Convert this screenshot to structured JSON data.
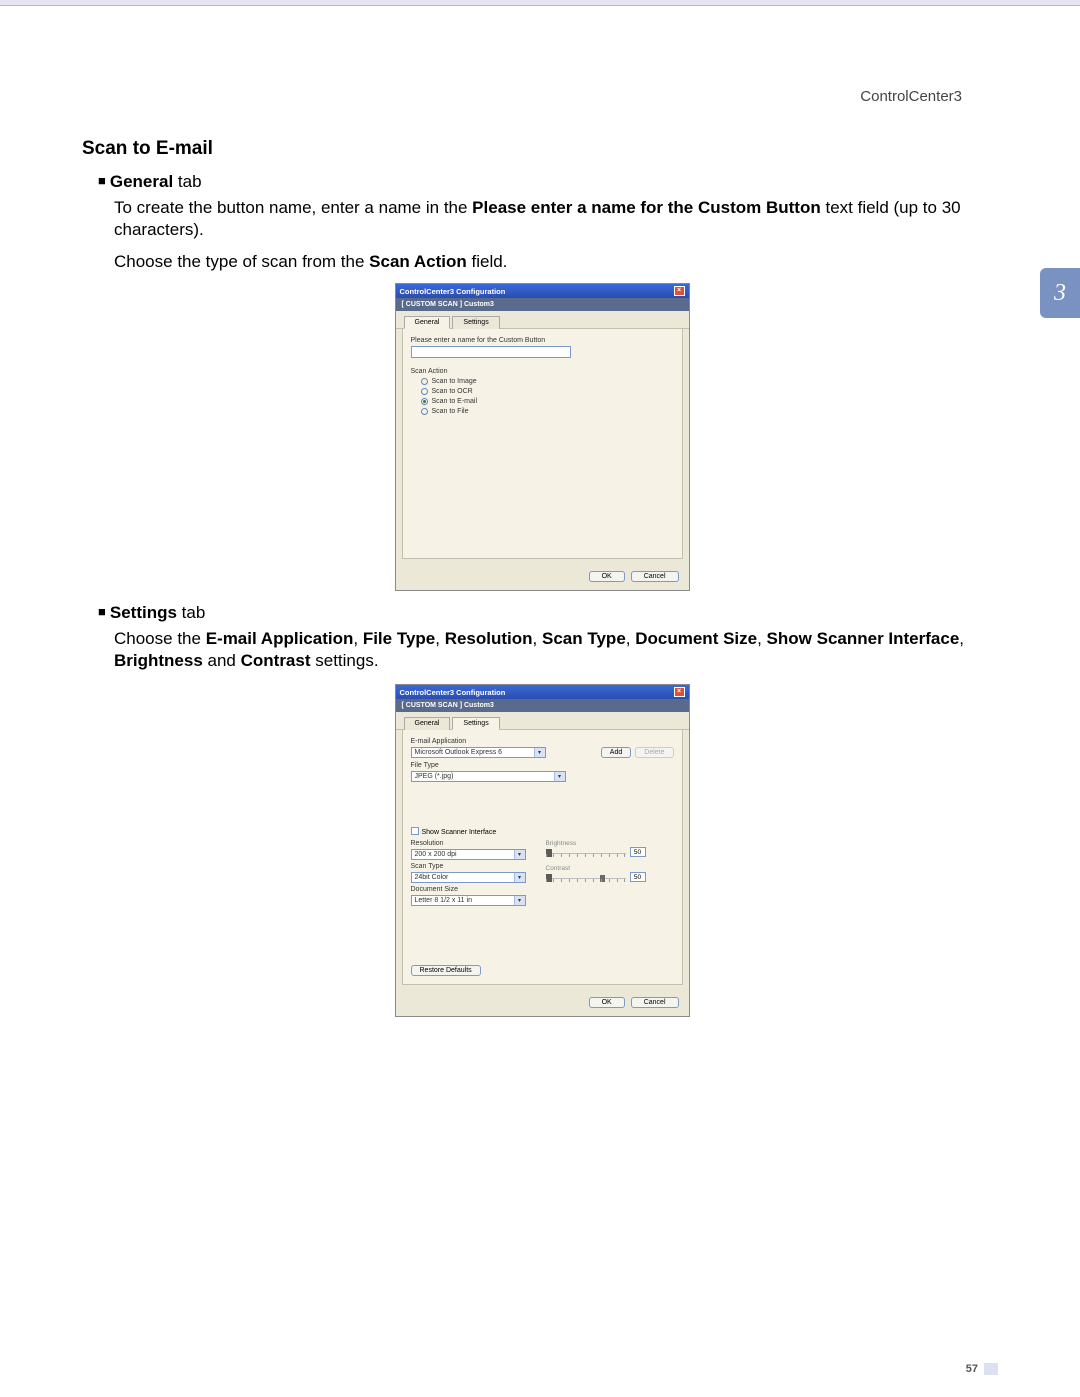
{
  "header": {
    "label": "ControlCenter3"
  },
  "section_title": "Scan to E-mail",
  "chapter_tab": "3",
  "page_number": "57",
  "general": {
    "heading_bold": "General",
    "heading_suffix": " tab",
    "para1_pre": "To create the button name, enter a name in the ",
    "para1_bold": "Please enter a name for the Custom Button",
    "para1_post": " text field (up to 30 characters).",
    "para2_pre": "Choose the type of scan from the ",
    "para2_bold": "Scan Action",
    "para2_post": " field."
  },
  "dialog1": {
    "title": "ControlCenter3 Configuration",
    "subtitle": "[  CUSTOM SCAN  ]   Custom3",
    "tab_general": "General",
    "tab_settings": "Settings",
    "name_label": "Please enter a name for the Custom Button",
    "group_label": "Scan Action",
    "radio1": "Scan to Image",
    "radio2": "Scan to OCR",
    "radio3": "Scan to E-mail",
    "radio4": "Scan to File",
    "ok": "OK",
    "cancel": "Cancel"
  },
  "settings": {
    "heading_bold": "Settings",
    "heading_suffix": " tab",
    "para_pre": "Choose the ",
    "b1": "E-mail Application",
    "c1": ", ",
    "b2": "File Type",
    "c2": ", ",
    "b3": "Resolution",
    "c3": ", ",
    "b4": "Scan Type",
    "c4": ", ",
    "b5": "Document Size",
    "c5": ", ",
    "b6": "Show Scanner Interface",
    "c6": ", ",
    "b7": "Brightness",
    "c7": " and ",
    "b8": "Contrast",
    "para_post": " settings."
  },
  "dialog2": {
    "title": "ControlCenter3 Configuration",
    "subtitle": "[  CUSTOM SCAN  ]   Custom3",
    "tab_general": "General",
    "tab_settings": "Settings",
    "email_label": "E-mail Application",
    "email_value": "Microsoft Outlook Express 6",
    "add": "Add",
    "delete": "Delete",
    "filetype_label": "File Type",
    "filetype_value": "JPEG (*.jpg)",
    "show_scanner": "Show Scanner Interface",
    "resolution_label": "Resolution",
    "resolution_value": "200 x 200 dpi",
    "scantype_label": "Scan Type",
    "scantype_value": "24bit Color",
    "docsize_label": "Document Size",
    "docsize_value": "Letter 8 1/2 x 11 in",
    "brightness_label": "Brightness",
    "brightness_value": "50",
    "contrast_label": "Contrast",
    "contrast_value": "50",
    "restore": "Restore Defaults",
    "ok": "OK",
    "cancel": "Cancel"
  }
}
